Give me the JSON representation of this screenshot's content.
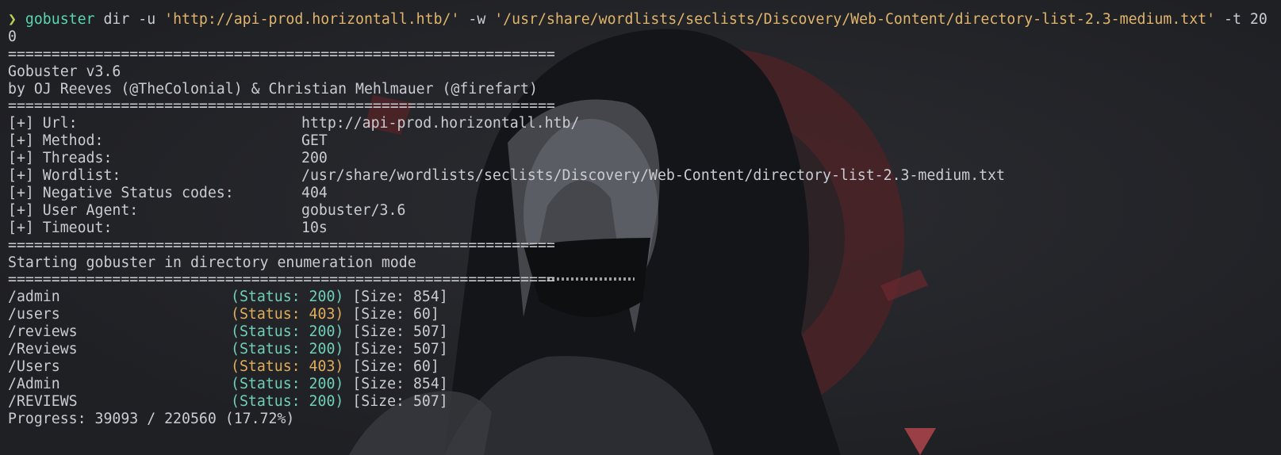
{
  "command": {
    "prompt_glyph": "❯",
    "tool": "gobuster",
    "args": " dir -u ",
    "url_arg": "'http://api-prod.horizontall.htb/'",
    "flag_w": " -w ",
    "wordlist_arg": "'/usr/share/wordlists/seclists/Discovery/Web-Content/directory-list-2.3-medium.txt'",
    "flag_t": " -t 200"
  },
  "separator": "===============================================================",
  "banner": {
    "version": "Gobuster v3.6",
    "authors": "by OJ Reeves (@TheColonial) & Christian Mehlmauer (@firefart)"
  },
  "config": [
    {
      "label": "[+] Url:",
      "value": "http://api-prod.horizontall.htb/"
    },
    {
      "label": "[+] Method:",
      "value": "GET"
    },
    {
      "label": "[+] Threads:",
      "value": "200"
    },
    {
      "label": "[+] Wordlist:",
      "value": "/usr/share/wordlists/seclists/Discovery/Web-Content/directory-list-2.3-medium.txt"
    },
    {
      "label": "[+] Negative Status codes:",
      "value": "404"
    },
    {
      "label": "[+] User Agent:",
      "value": "gobuster/3.6"
    },
    {
      "label": "[+] Timeout:",
      "value": "10s"
    }
  ],
  "mode_text": "Starting gobuster in directory enumeration mode",
  "results": [
    {
      "path": "/admin",
      "status": "(Status: 200)",
      "size": "[Size: 854]"
    },
    {
      "path": "/users",
      "status": "(Status: 403)",
      "size": "[Size: 60]"
    },
    {
      "path": "/reviews",
      "status": "(Status: 200)",
      "size": "[Size: 507]"
    },
    {
      "path": "/Reviews",
      "status": "(Status: 200)",
      "size": "[Size: 507]"
    },
    {
      "path": "/Users",
      "status": "(Status: 403)",
      "size": "[Size: 60]"
    },
    {
      "path": "/Admin",
      "status": "(Status: 200)",
      "size": "[Size: 854]"
    },
    {
      "path": "/REVIEWS",
      "status": "(Status: 200)",
      "size": "[Size: 507]"
    }
  ],
  "progress": "Progress: 39093 / 220560 (17.72%)",
  "colors": {
    "background": "#202125",
    "status_200": "#6fcfb8",
    "status_403": "#e0ad5a",
    "string": "#e0b46b",
    "prompt": "#b4d25a"
  }
}
